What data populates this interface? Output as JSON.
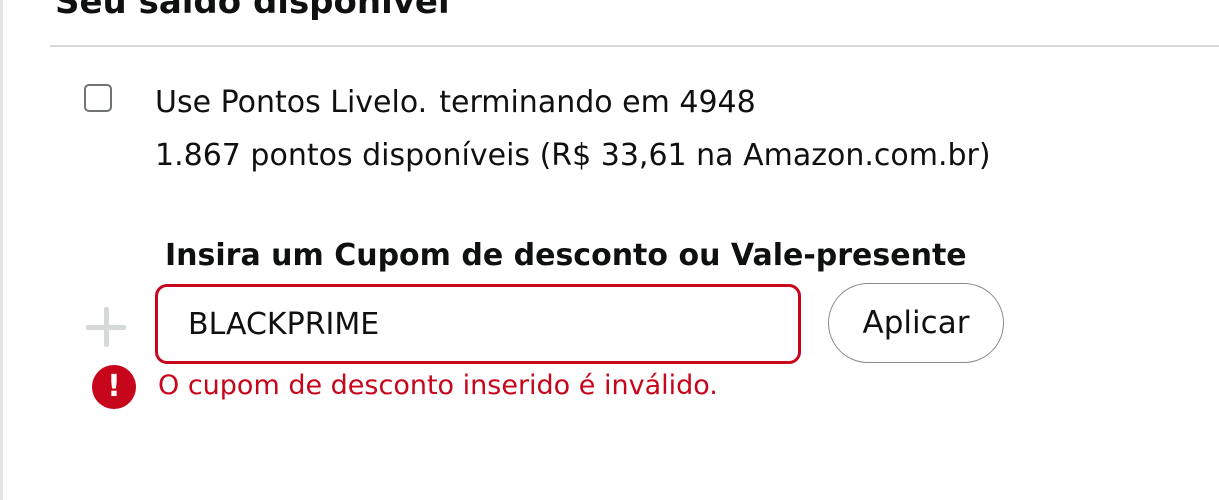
{
  "section": {
    "title": "Seu saldo disponível"
  },
  "points": {
    "program": "Use Pontos Livelo.",
    "ending": "terminando em 4948",
    "available": "1.867 pontos disponíveis (R$ 33,61 na Amazon.com.br)",
    "checked": false
  },
  "coupon": {
    "label": "Insira um Cupom de desconto ou Vale-presente",
    "value": "BLACKPRIME",
    "apply_label": "Aplicar",
    "error_message": "O cupom de desconto inserido é inválido.",
    "error_icon_glyph": "!"
  },
  "colors": {
    "error": "#c7051b",
    "text": "#0f1111",
    "divider": "#d5d9d9"
  },
  "icons": {
    "plus": "plus-icon",
    "error": "error-icon"
  }
}
